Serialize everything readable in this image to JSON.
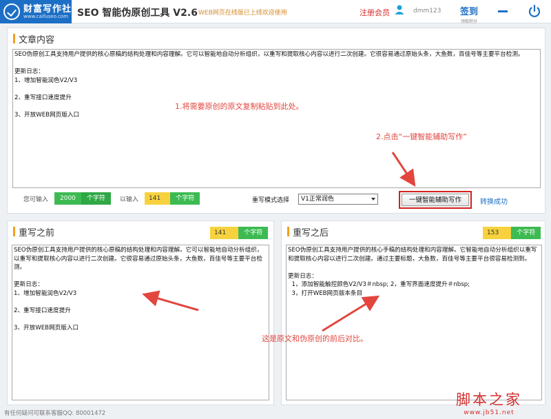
{
  "titlebar": {
    "logo_cn": "财富写作社",
    "logo_url": "www.caifuseo.com",
    "app_title": "SEO 智能伪原创工具 V2.6",
    "notice": "WEB网页在线版已上线欢迎使用",
    "register": "注册会员",
    "username": "dmm123",
    "checkin_main": "签到",
    "checkin_sub": "领取积分",
    "accent_color": "#1d6fc5"
  },
  "article": {
    "title": "文章内容",
    "text": "SEO伪原创工具支持用户提供的核心原稿的结构处理和内容理解。它可以智能地自动分析组织，以重写和提取核心内容以进行二次创建。它很容易通过原始头条，大鱼数，百佳号等主要平台检测。\n\n更新日志：\n1、增加智能润色V2/V3\n\n2、重写接口速度提升\n\n3、开放WEB网页版入口",
    "can_input_label": "您可输入",
    "can_input_value": "2000",
    "can_input_unit": "个字符",
    "entered_label": "以输入",
    "entered_value": "141",
    "entered_unit": "个字符",
    "mode_label": "重写模式选择",
    "mode_selected": "V1正常润色",
    "rewrite_button": "一键智能辅助写作",
    "status": "转换成功"
  },
  "before": {
    "title": "重写之前",
    "count": "141",
    "unit": "个字符",
    "text": "SEO伪原创工具支持用户提供的核心原稿的结构处理和内容理解。它可以智能地自动分析组织，以重写和提取核心内容以进行二次创建。它很容易通过原始头条，大鱼数，百佳号等主要平台检测。\n\n更新日志：\n1、增加智能润色V2/V3\n\n2、重写接口速度提升\n\n3、开放WEB网页版入口"
  },
  "after": {
    "title": "重写之后",
    "count": "153",
    "unit": "个字符",
    "text": "SEO伪原创工具支持用户提供的核心手稿的结构处理和内容理解。它智能地自动分析组织以重写和提取核心内容以进行二次创建。通过主要标题，大鱼数，百佳号等主要平台很容易检测到。\n\n更新日志：\n  1，添加智能触控颜色V2/V3＃nbsp; 2，重写界面速度提升＃nbsp;\n  3，打开WEB网页版本条目"
  },
  "annotations": {
    "step1": "1.将需要原创的原文复制粘贴到此处。",
    "step2": "2.点击“一键智能辅助写作”",
    "compare": "这是原文和伪原创的前后对比。"
  },
  "footer": {
    "contact": "有任何疑问可联系客服QQ: 80001472"
  },
  "watermark": {
    "cn": "脚本之家",
    "url": "www.jb51.net"
  }
}
